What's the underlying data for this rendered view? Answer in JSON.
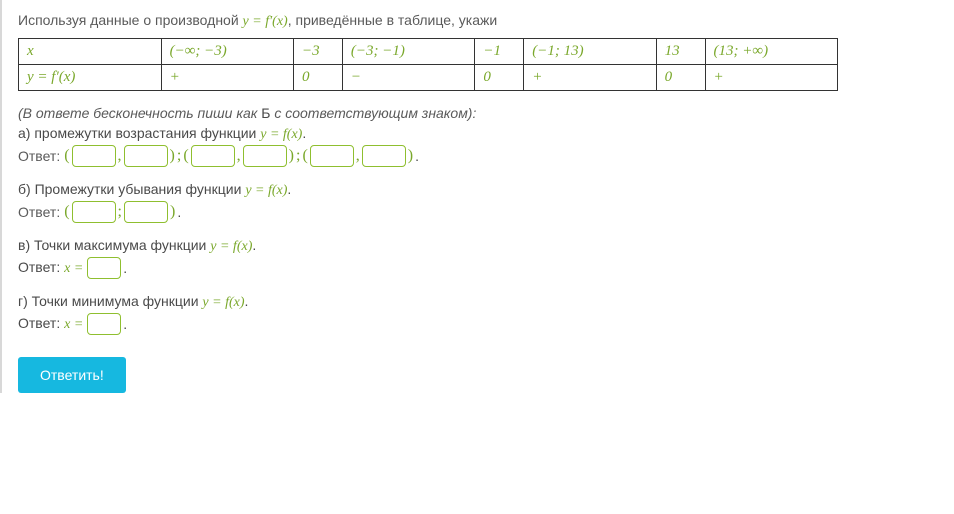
{
  "intro_prefix": "Используя данные о производной ",
  "intro_math": "y = f′(x)",
  "intro_suffix": ", приведённые в таблице, укажи",
  "table": {
    "row1": [
      "x",
      "(−∞; −3)",
      "−3",
      "(−3; −1)",
      "−1",
      "(−1; 13)",
      "13",
      "(13; +∞)"
    ],
    "row2": [
      "y = f′(x)",
      "+",
      "0",
      "−",
      "0",
      "+",
      "0",
      "+"
    ]
  },
  "hint_prefix": "(В ответе бесконечность пиши как ",
  "hint_b": "Б",
  "hint_suffix": " с соответствующим знаком):",
  "a_prefix": "а) промежутки возрастания функции ",
  "fx": "y = f(x)",
  "b_prefix": "б) Промежутки убывания функции ",
  "c_prefix": "в) Точки максимума функции ",
  "d_prefix": "г) Точки минимума функции ",
  "answer_label": "Ответ:",
  "answer_x_eq": "Ответ: x =",
  "submit": "Ответить!",
  "chart_data": {
    "type": "table",
    "columns": [
      "x",
      "(−∞; −3)",
      "−3",
      "(−3; −1)",
      "−1",
      "(−1; 13)",
      "13",
      "(13; +∞)"
    ],
    "rows": [
      {
        "label": "y = f′(x)",
        "values": [
          "+",
          "0",
          "−",
          "0",
          "+",
          "0",
          "+"
        ]
      }
    ]
  }
}
